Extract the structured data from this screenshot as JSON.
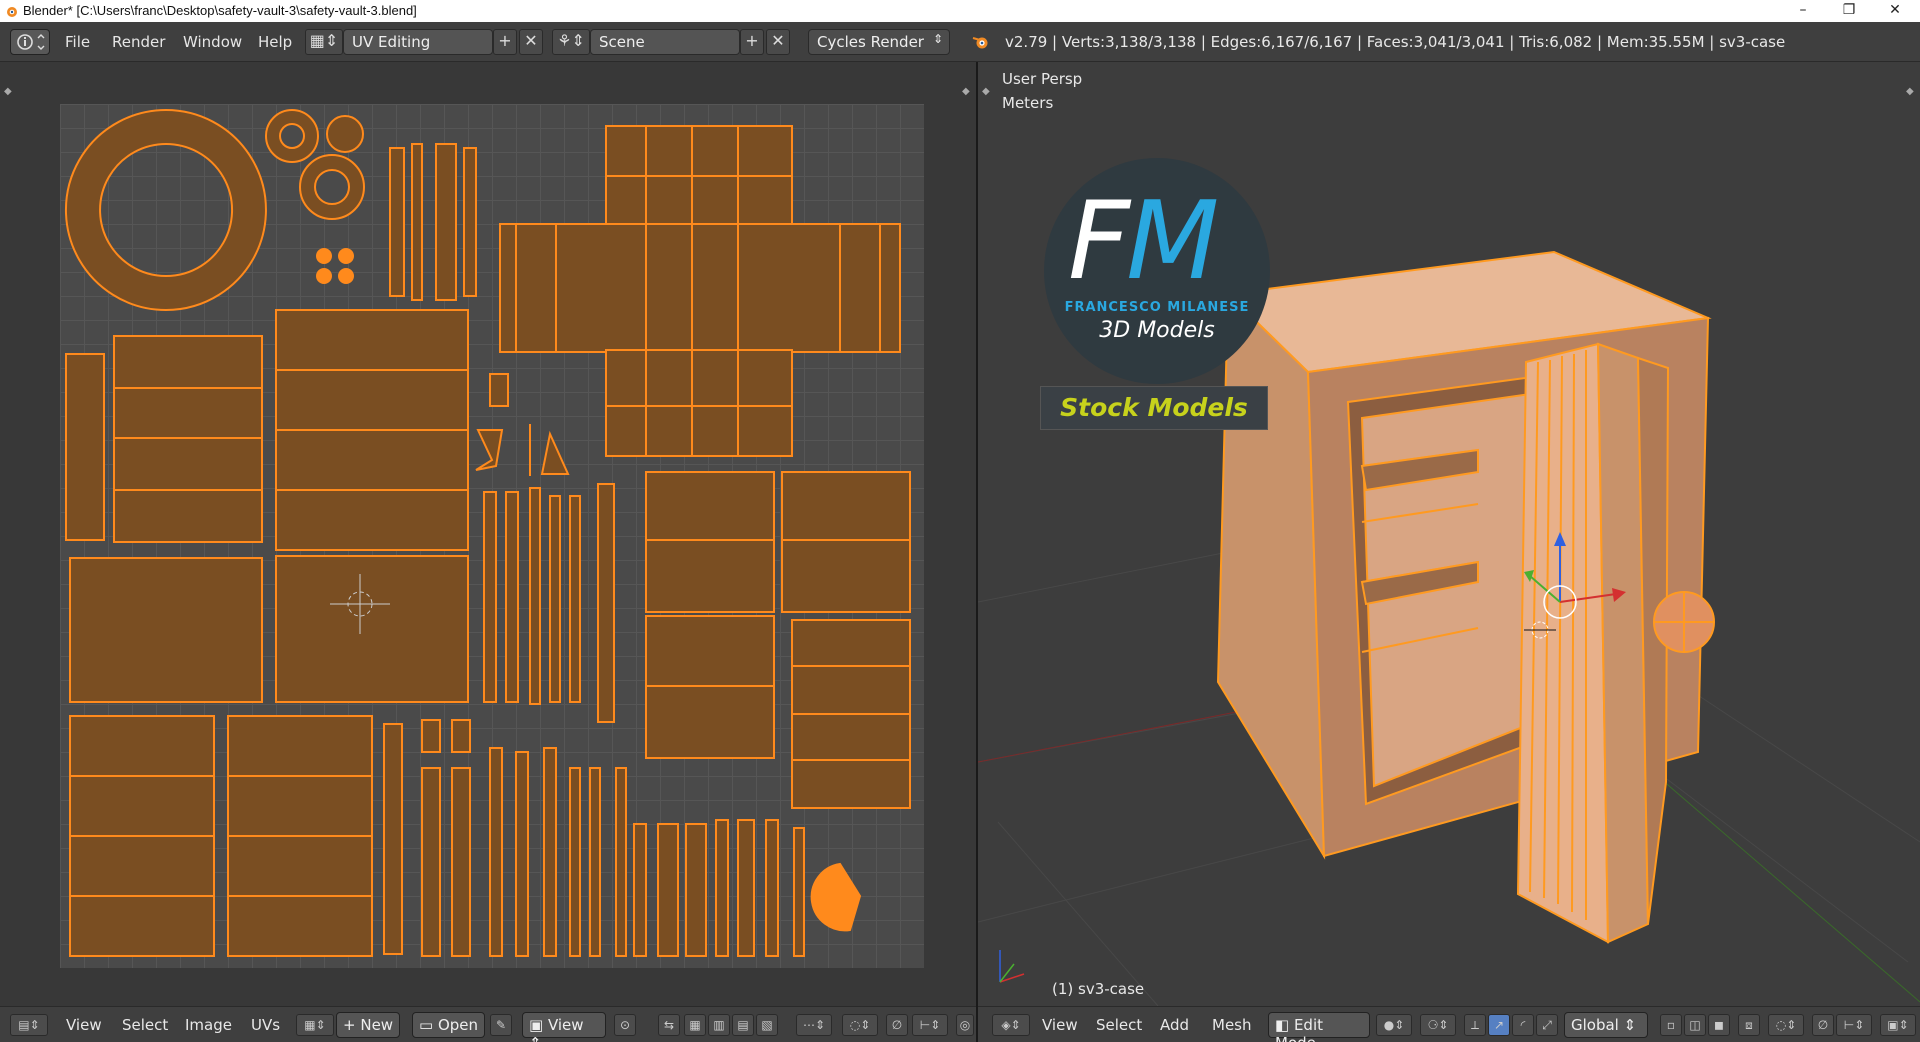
{
  "window": {
    "title": "Blender* [C:\\Users\\franc\\Desktop\\safety-vault-3\\safety-vault-3.blend]",
    "minimize_glyph": "–",
    "restore_glyph": "❐",
    "close_glyph": "✕"
  },
  "info_header": {
    "menus": [
      "File",
      "Render",
      "Window",
      "Help"
    ],
    "screen_layout": "UV Editing",
    "scene": "Scene",
    "render_engine": "Cycles Render",
    "stats": "v2.79 | Verts:3,138/3,138 | Edges:6,167/6,167 | Faces:3,041/3,041 | Tris:6,082 | Mem:35.55M | sv3-case"
  },
  "uv_editor": {
    "menus": [
      "View",
      "Select",
      "Image",
      "UVs"
    ],
    "new_label": "New",
    "open_label": "Open",
    "view_label": "View"
  },
  "viewport": {
    "view_name": "User Persp",
    "units": "Meters",
    "object_label": "(1) sv3-case",
    "menus": [
      "View",
      "Select",
      "Add",
      "Mesh"
    ],
    "mode": "Edit Mode",
    "orientation": "Global"
  },
  "watermark": {
    "letter_f": "F",
    "letter_m": "M",
    "author": "FRANCESCO MILANESE",
    "subtitle": "3D Models",
    "badge": "Stock Models"
  },
  "colors": {
    "uv_fill": "#7a4e22",
    "uv_edge": "#ff8a1c",
    "mesh_face": "#c8926a",
    "mesh_edge": "#ff9a20",
    "axis_x": "#d43030",
    "axis_y": "#4ab030",
    "axis_z": "#3060e0"
  }
}
